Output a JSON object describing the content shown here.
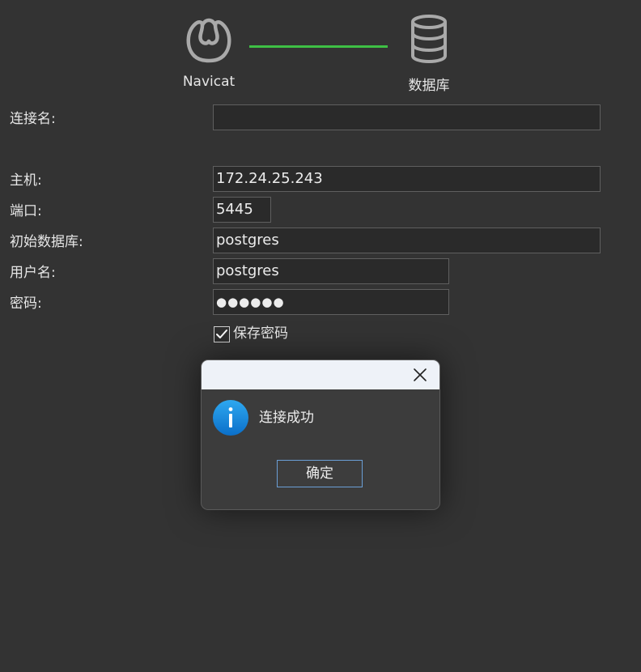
{
  "header": {
    "source_label": "Navicat",
    "target_label": "数据库",
    "connector_color": "#3ec045",
    "source_icon": "navicat-logo-icon",
    "target_icon": "database-icon"
  },
  "form": {
    "connection_name": {
      "label": "连接名:",
      "value": ""
    },
    "host": {
      "label": "主机:",
      "value": "172.24.25.243"
    },
    "port": {
      "label": "端口:",
      "value": "5445"
    },
    "initial_database": {
      "label": "初始数据库:",
      "value": "postgres"
    },
    "username": {
      "label": "用户名:",
      "value": "postgres"
    },
    "password": {
      "label": "密码:",
      "value": "●●●●●●"
    },
    "save_password": {
      "label": "保存密码",
      "checked": true
    }
  },
  "dialog": {
    "message": "连接成功",
    "ok_label": "确定",
    "icon": "info-icon",
    "close_icon": "close-icon"
  }
}
